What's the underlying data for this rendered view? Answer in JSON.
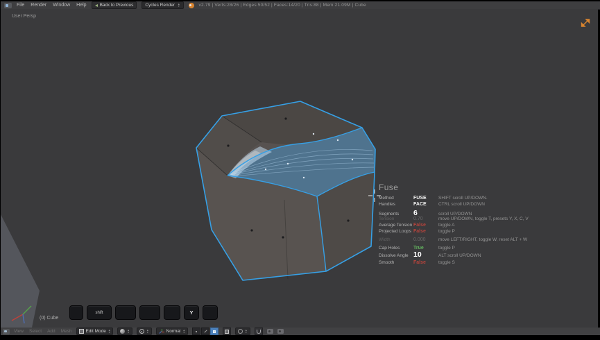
{
  "top_bar": {
    "menus": [
      "File",
      "Render",
      "Window",
      "Help"
    ],
    "back_button": "Back to Previous",
    "engine": "Cycles Render",
    "stats": "v2.79 | Verts:28/26 | Edges:50/52 | Faces:14/20 | Tris:88 | Mem:21.09M | Cube"
  },
  "viewport": {
    "view_label": "User Persp",
    "object_label": "(0) Cube"
  },
  "keycast": [
    "",
    "shift",
    "",
    "",
    "",
    "Y",
    ""
  ],
  "fuse_panel": {
    "title": "Fuse",
    "rows": [
      {
        "label": "Method",
        "value": "FUSE",
        "hint": "SHIFT scroll UP/DOWN.",
        "style": "strong"
      },
      {
        "label": "Handles",
        "value": "FACE",
        "hint": "CTRL scroll UP/DOWN",
        "style": "strong"
      },
      {
        "label": "Segments",
        "value": "6",
        "hint": "scroll UP/DOWN",
        "style": "big",
        "gap": true
      },
      {
        "label": "Tension",
        "value": "0.70",
        "hint": "move UP/DOWN, toggle T, presets Y, X, C, V",
        "style": "dim",
        "dim_label": true
      },
      {
        "label": "Average Tension",
        "value": "False",
        "hint": "toggle A",
        "style": "false"
      },
      {
        "label": "Projected Loops",
        "value": "False",
        "hint": "toggle P",
        "style": "false"
      },
      {
        "label": "Width",
        "value": "0.000",
        "hint": "move LEFT/RIGHT, toggle W, reset ALT + W",
        "style": "dim",
        "dim_label": true,
        "gap": true
      },
      {
        "label": "Cap Holes",
        "value": "True",
        "hint": "toggle P",
        "style": "true",
        "gap": true
      },
      {
        "label": "Dissolve Angle",
        "value": "10",
        "hint": "ALT scroll UP/DOWN",
        "style": "big"
      },
      {
        "label": "Smooth",
        "value": "False",
        "hint": "toggle S",
        "style": "false",
        "gap": true
      }
    ]
  },
  "header_bar": {
    "menus": [
      "View",
      "Select",
      "Add",
      "Mesh"
    ],
    "mode": "Edit Mode",
    "orientation": "Normal"
  },
  "colors": {
    "accent_blue": "#36a0e6",
    "selected_fill": "rgba(70,162,228,0.42)",
    "value_red": "#b5443c",
    "value_green": "#63b35f",
    "icon_orange": "#d8842f"
  }
}
